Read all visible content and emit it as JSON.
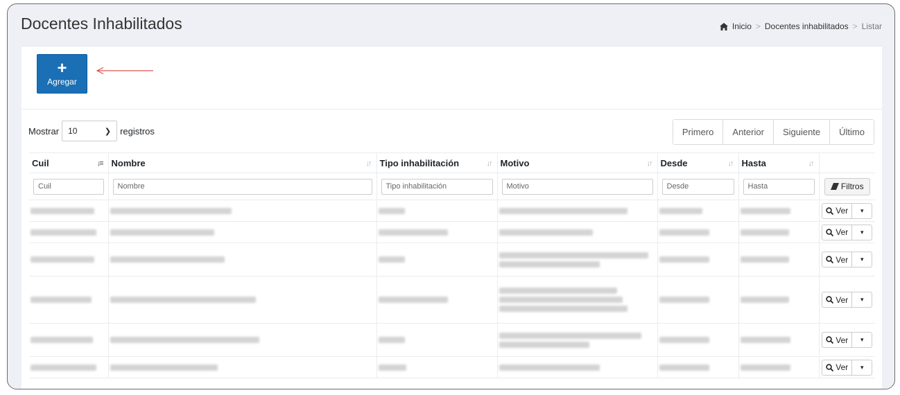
{
  "header": {
    "title": "Docentes Inhabilitados",
    "breadcrumb": {
      "home": "Inicio",
      "section": "Docentes inhabilitados",
      "current": "Listar",
      "separator": ">"
    }
  },
  "toolbar": {
    "add_icon": "+",
    "add_label": "Agregar"
  },
  "length": {
    "prefix": "Mostrar",
    "value": "10",
    "suffix": "registros"
  },
  "pagination": {
    "first": "Primero",
    "prev": "Anterior",
    "next": "Siguiente",
    "last": "Último"
  },
  "columns": [
    {
      "label": "Cuil",
      "placeholder": "Cuil"
    },
    {
      "label": "Nombre",
      "placeholder": "Nombre"
    },
    {
      "label": "Tipo inhabilitación",
      "placeholder": "Tipo inhabilitación"
    },
    {
      "label": "Motivo",
      "placeholder": "Motivo"
    },
    {
      "label": "Desde",
      "placeholder": "Desde"
    },
    {
      "label": "Hasta",
      "placeholder": "Hasta"
    }
  ],
  "filters_button": "Filtros",
  "row_action": {
    "label": "Ver",
    "icon": "search-icon",
    "caret": "▾"
  },
  "colors": {
    "primary": "#1a6fb5",
    "annotation_arrow": "#d9534f"
  }
}
